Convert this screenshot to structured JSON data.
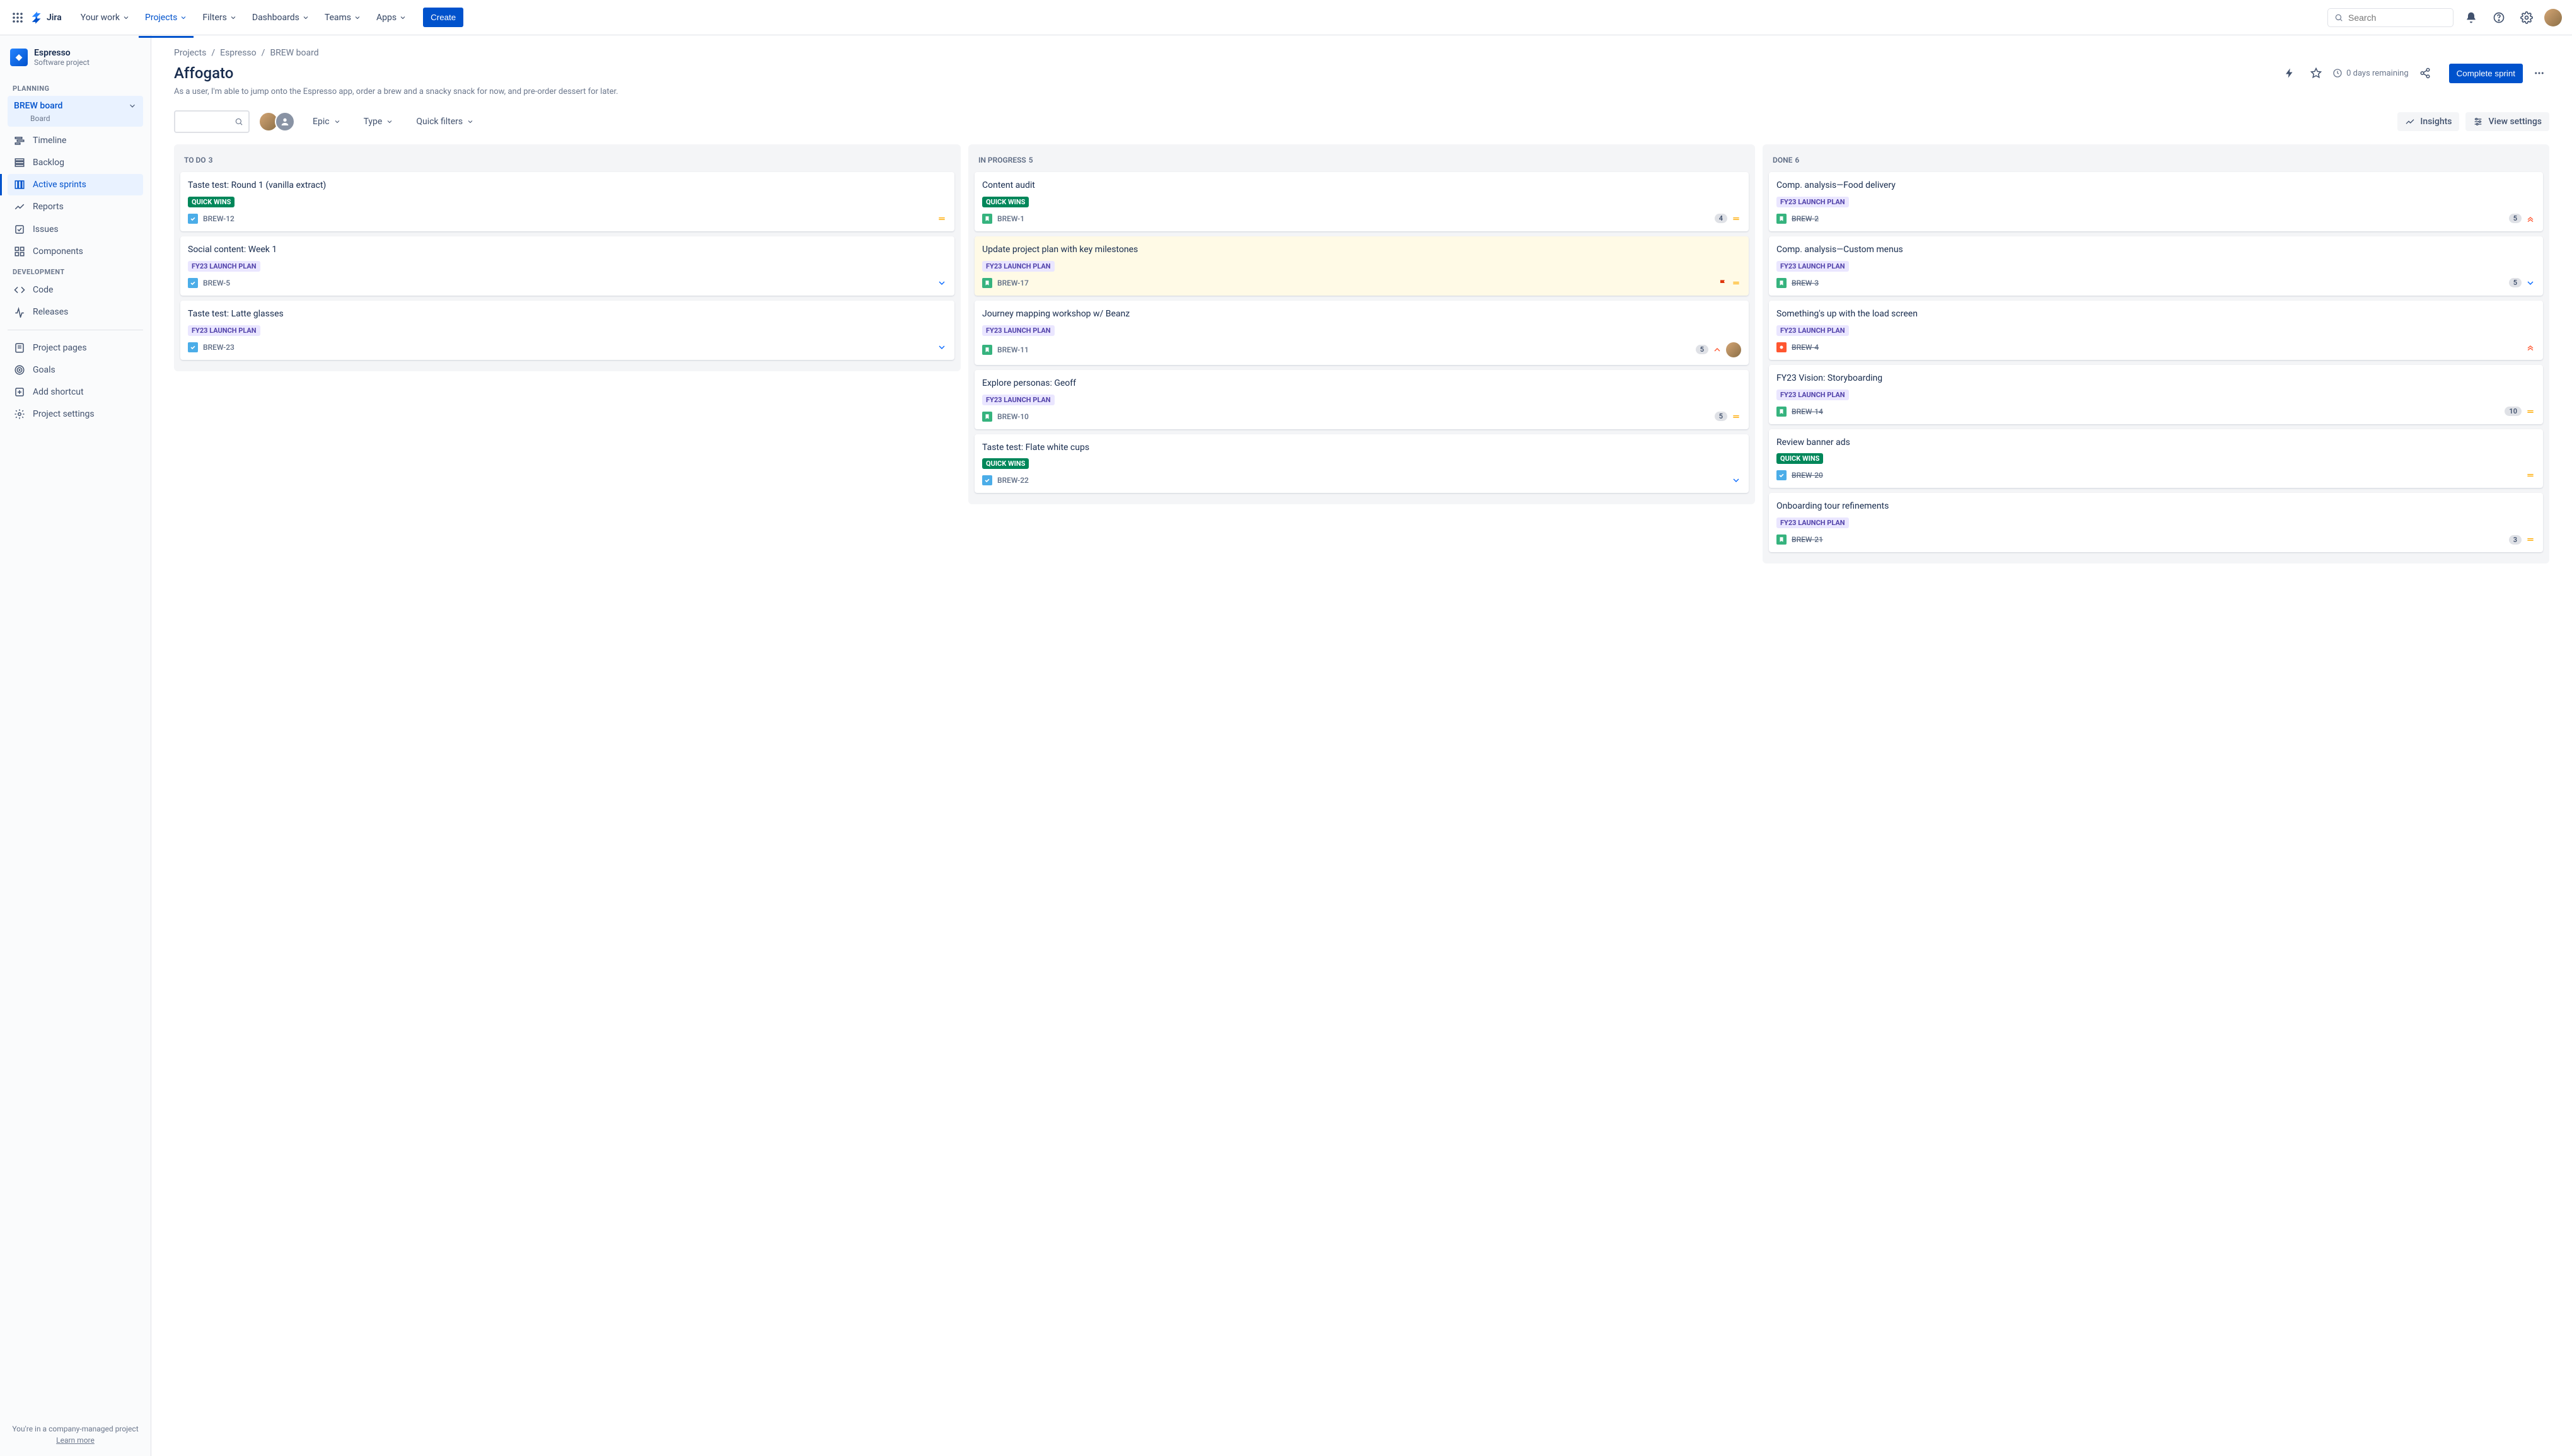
{
  "brand": "Jira",
  "topnav": {
    "items": [
      "Your work",
      "Projects",
      "Filters",
      "Dashboards",
      "Teams",
      "Apps"
    ],
    "active_index": 1,
    "create": "Create",
    "search_placeholder": "Search"
  },
  "project": {
    "name": "Espresso",
    "subtitle": "Software project"
  },
  "sidebar": {
    "sections": {
      "planning_label": "PLANNING",
      "development_label": "DEVELOPMENT"
    },
    "board_name": "BREW board",
    "board_sub": "Board",
    "planning": [
      "Timeline",
      "Backlog",
      "Active sprints",
      "Reports"
    ],
    "other": [
      "Issues",
      "Components"
    ],
    "dev": [
      "Code",
      "Releases"
    ],
    "footer_links": [
      "Project pages",
      "Goals",
      "Add shortcut",
      "Project settings"
    ],
    "foot_text": "You're in a company-managed project",
    "foot_link": "Learn more"
  },
  "breadcrumbs": [
    "Projects",
    "Espresso",
    "BREW board"
  ],
  "page": {
    "title": "Affogato",
    "subtitle": "As a user, I'm able to jump onto the Espresso app, order a brew and a snacky snack for now, and pre-order dessert for later.",
    "days": "0 days remaining",
    "complete": "Complete sprint"
  },
  "toolbar": {
    "filters": [
      "Epic",
      "Type",
      "Quick filters"
    ],
    "insights": "Insights",
    "view_settings": "View settings"
  },
  "tags": {
    "quick_wins": "QUICK WINS",
    "launch_plan": "FY23 LAUNCH PLAN"
  },
  "columns": [
    {
      "name": "TO DO",
      "count": 3
    },
    {
      "name": "IN PROGRESS",
      "count": 5
    },
    {
      "name": "DONE",
      "count": 6
    }
  ],
  "cards": {
    "todo": [
      {
        "title": "Taste test: Round 1 (vanilla extract)",
        "tag": "quick_wins",
        "type": "task",
        "key": "BREW-12",
        "prio": "medium"
      },
      {
        "title": "Social content: Week 1",
        "tag": "launch_plan",
        "type": "task",
        "key": "BREW-5",
        "prio": "low"
      },
      {
        "title": "Taste test: Latte glasses",
        "tag": "launch_plan",
        "type": "task",
        "key": "BREW-23",
        "prio": "low"
      }
    ],
    "progress": [
      {
        "title": "Content audit",
        "tag": "quick_wins",
        "type": "story",
        "key": "BREW-1",
        "points": 4,
        "prio": "medium"
      },
      {
        "title": "Update project plan with key milestones",
        "tag": "launch_plan",
        "type": "story",
        "key": "BREW-17",
        "flagged": true,
        "prio": "medium",
        "hl": true
      },
      {
        "title": "Journey mapping workshop w/ Beanz",
        "tag": "launch_plan",
        "type": "story",
        "key": "BREW-11",
        "points": 5,
        "prio": "high",
        "assignee": true
      },
      {
        "title": "Explore personas: Geoff",
        "tag": "launch_plan",
        "type": "story",
        "key": "BREW-10",
        "points": 5,
        "prio": "medium"
      },
      {
        "title": "Taste test: Flate white cups",
        "tag": "quick_wins",
        "type": "task",
        "key": "BREW-22",
        "prio": "low"
      }
    ],
    "done": [
      {
        "title": "Comp. analysis—Food delivery",
        "tag": "launch_plan",
        "type": "story",
        "key": "BREW-2",
        "points": 5,
        "prio": "highest"
      },
      {
        "title": "Comp. analysis—Custom menus",
        "tag": "launch_plan",
        "type": "story",
        "key": "BREW-3",
        "points": 5,
        "prio": "low"
      },
      {
        "title": "Something's up with the load screen",
        "tag": "launch_plan",
        "type": "bug",
        "key": "BREW-4",
        "prio": "highest"
      },
      {
        "title": "FY23 Vision: Storyboarding",
        "tag": "launch_plan",
        "type": "story",
        "key": "BREW-14",
        "points": 10,
        "prio": "medium"
      },
      {
        "title": "Review banner ads",
        "tag": "quick_wins",
        "type": "task",
        "key": "BREW-20",
        "prio": "medium"
      },
      {
        "title": "Onboarding tour refinements",
        "tag": "launch_plan",
        "type": "story",
        "key": "BREW-21",
        "points": 3,
        "prio": "medium"
      }
    ]
  }
}
